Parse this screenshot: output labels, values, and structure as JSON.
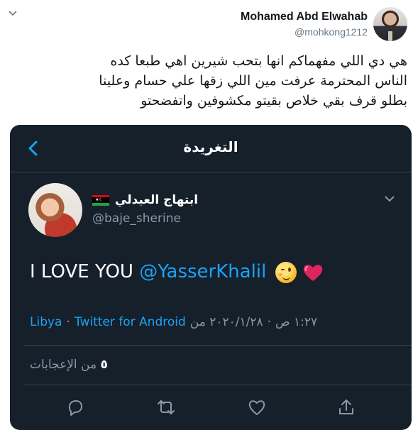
{
  "tweet": {
    "author_name": "Mohamed Abd Elwahab",
    "author_handle": "@mohkong1212",
    "text_lines": [
      "هي دي اللي مفهماكم انها بتحب شيرين اهي طبعا كده",
      "الناس المحترمة عرفت مين اللي زقها علي حسام وعلينا",
      "بطلو قرف بقي خلاص بقيتو مكشوفين واتفضحتو"
    ]
  },
  "screenshot": {
    "header_title": "التغريدة",
    "user_name": "ابتهاج العبدلي",
    "user_handle": "@baje_sherine",
    "body_text": "I LOVE YOU ",
    "mention": "@YasserKhalil",
    "meta_time": "١:٢٧ ص",
    "meta_sep1": "·",
    "meta_date": "٢٠٢٠/١/٢٨ من",
    "meta_source": "Twitter for Android",
    "meta_sep2": "·",
    "meta_location": "Libya",
    "likes_count": "٥",
    "likes_label": "من الإعجابات"
  },
  "colors": {
    "dark_bg": "#15202b",
    "accent": "#1da1f2",
    "muted": "#8899a6",
    "heart": "#e0245e"
  },
  "icons": [
    "chevron-down-icon",
    "back-arrow-icon",
    "libya-flag-icon",
    "wink-emoji-icon",
    "red-heart-emoji-icon",
    "reply-icon",
    "retweet-icon",
    "like-icon",
    "share-icon"
  ]
}
